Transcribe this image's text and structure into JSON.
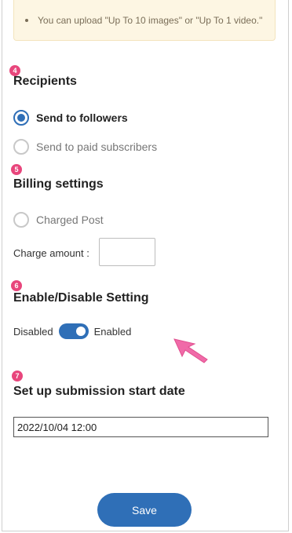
{
  "notice": {
    "text": "You can upload \"Up To 10 images\" or \"Up To 1 video.\""
  },
  "recipients": {
    "step": "4",
    "title": "Recipients",
    "options": [
      {
        "label": "Send to followers",
        "selected": true
      },
      {
        "label": "Send to paid subscribers",
        "selected": false
      }
    ]
  },
  "billing": {
    "step": "5",
    "title": "Billing settings",
    "charged_post_label": "Charged Post",
    "charged_post_selected": false,
    "charge_amount_label": "Charge amount :",
    "charge_amount_value": ""
  },
  "enable_disable": {
    "step": "6",
    "title": "Enable/Disable Setting",
    "off_label": "Disabled",
    "on_label": "Enabled",
    "enabled": true
  },
  "start_date": {
    "step": "7",
    "title": "Set up submission start date",
    "value": "2022/10/04 12:00"
  },
  "actions": {
    "save_label": "Save"
  },
  "colors": {
    "accent": "#2f6fb7",
    "badge": "#e8467c",
    "cursor": "#f06aa8",
    "notice_bg": "#fdf6e3"
  }
}
